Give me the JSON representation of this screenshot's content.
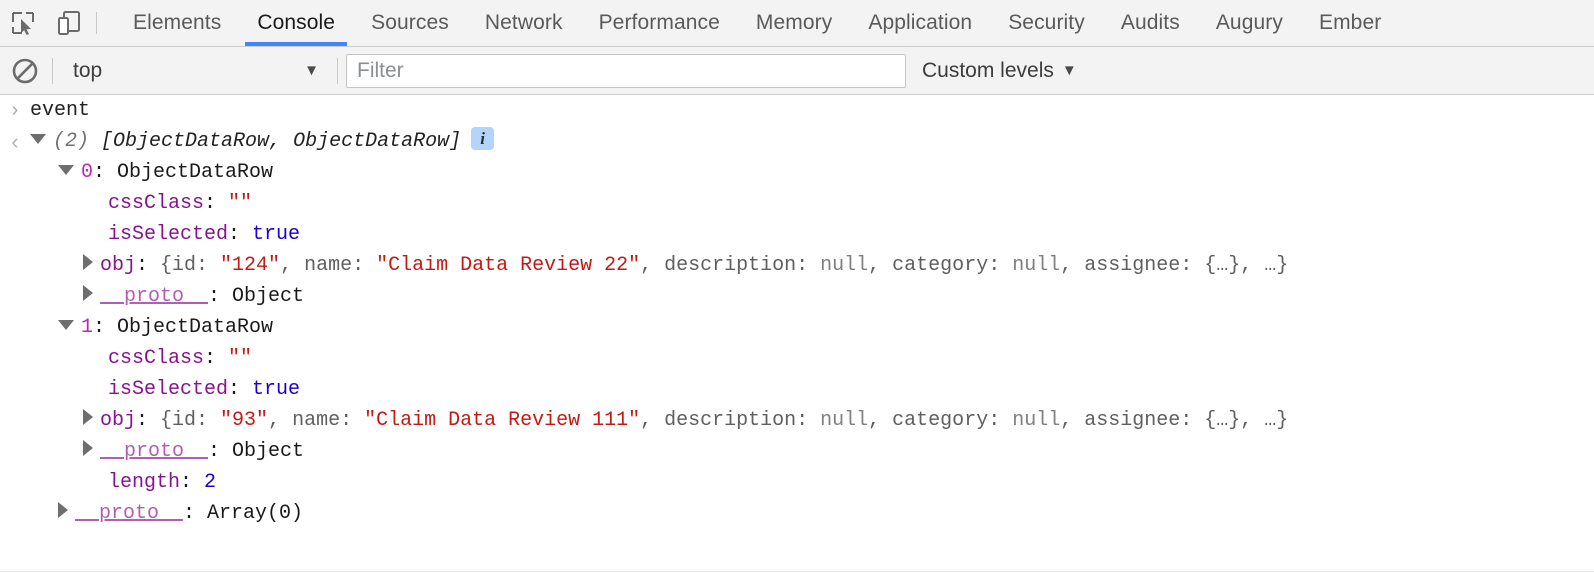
{
  "theme": {
    "accent": "#4285f4",
    "toolbar_bg": "#f3f3f3",
    "border": "#cdcdcd",
    "string_color": "#c41a16",
    "number_color": "#1c00cf",
    "property_color": "#881391",
    "index_color": "#c125b8",
    "proto_color": "#b15fb3",
    "null_color": "#808080",
    "info_badge_bg": "#b3d4fd"
  },
  "toolbar": {
    "inspect_icon": "inspect-element-icon",
    "device_icon": "device-toolbar-icon",
    "tabs": [
      {
        "label": "Elements",
        "active": false
      },
      {
        "label": "Console",
        "active": true
      },
      {
        "label": "Sources",
        "active": false
      },
      {
        "label": "Network",
        "active": false
      },
      {
        "label": "Performance",
        "active": false
      },
      {
        "label": "Memory",
        "active": false
      },
      {
        "label": "Application",
        "active": false
      },
      {
        "label": "Security",
        "active": false
      },
      {
        "label": "Audits",
        "active": false
      },
      {
        "label": "Augury",
        "active": false
      },
      {
        "label": "Ember",
        "active": false
      }
    ]
  },
  "filterbar": {
    "clear_icon": "clear-console-icon",
    "context": "top",
    "context_caret": "▼",
    "filter_value": "",
    "filter_placeholder": "Filter",
    "levels_label": "Custom levels",
    "levels_caret": "▼"
  },
  "console": {
    "prompt_glyph": "›",
    "result_glyph": "‹",
    "input_text": "event",
    "info_badge": "i",
    "summary": {
      "count": "(2)",
      "body": "[ObjectDataRow, ObjectDataRow]"
    },
    "lines": [
      {
        "id": "row0-header",
        "indent": 1,
        "tri": "open",
        "key": "0",
        "key_kind": "index",
        "sep": ": ",
        "value": "ObjectDataRow",
        "value_kind": "plain"
      },
      {
        "id": "row0-cssClass",
        "indent": 2,
        "tri": "none",
        "key": "cssClass",
        "key_kind": "name",
        "sep": ": ",
        "value": "\"\"",
        "value_kind": "string"
      },
      {
        "id": "row0-isSelected",
        "indent": 2,
        "tri": "none",
        "key": "isSelected",
        "key_kind": "name",
        "sep": ": ",
        "value": "true",
        "value_kind": "bool"
      },
      {
        "id": "row0-obj",
        "indent": 2,
        "tri": "closed",
        "key": "obj",
        "key_kind": "name",
        "sep": ": ",
        "value_kind": "object-preview",
        "preview": [
          {
            "t": "{id: ",
            "c": "dim"
          },
          {
            "t": "\"124\"",
            "c": "string"
          },
          {
            "t": ", name: ",
            "c": "dim"
          },
          {
            "t": "\"Claim Data Review 22\"",
            "c": "string"
          },
          {
            "t": ", description: ",
            "c": "dim"
          },
          {
            "t": "null",
            "c": "null"
          },
          {
            "t": ", category: ",
            "c": "dim"
          },
          {
            "t": "null",
            "c": "null"
          },
          {
            "t": ", assignee: ",
            "c": "dim"
          },
          {
            "t": "{…}, …}",
            "c": "dim"
          }
        ]
      },
      {
        "id": "row0-proto",
        "indent": 2,
        "tri": "closed",
        "key": "__proto__",
        "key_kind": "proto",
        "sep": ": ",
        "value": "Object",
        "value_kind": "plain"
      },
      {
        "id": "row1-header",
        "indent": 1,
        "tri": "open",
        "key": "1",
        "key_kind": "index",
        "sep": ": ",
        "value": "ObjectDataRow",
        "value_kind": "plain"
      },
      {
        "id": "row1-cssClass",
        "indent": 2,
        "tri": "none",
        "key": "cssClass",
        "key_kind": "name",
        "sep": ": ",
        "value": "\"\"",
        "value_kind": "string"
      },
      {
        "id": "row1-isSelected",
        "indent": 2,
        "tri": "none",
        "key": "isSelected",
        "key_kind": "name",
        "sep": ": ",
        "value": "true",
        "value_kind": "bool"
      },
      {
        "id": "row1-obj",
        "indent": 2,
        "tri": "closed",
        "key": "obj",
        "key_kind": "name",
        "sep": ": ",
        "value_kind": "object-preview",
        "preview": [
          {
            "t": "{id: ",
            "c": "dim"
          },
          {
            "t": "\"93\"",
            "c": "string"
          },
          {
            "t": ", name: ",
            "c": "dim"
          },
          {
            "t": "\"Claim Data Review 111\"",
            "c": "string"
          },
          {
            "t": ", description: ",
            "c": "dim"
          },
          {
            "t": "null",
            "c": "null"
          },
          {
            "t": ", category: ",
            "c": "dim"
          },
          {
            "t": "null",
            "c": "null"
          },
          {
            "t": ", assignee: ",
            "c": "dim"
          },
          {
            "t": "{…}, …}",
            "c": "dim"
          }
        ]
      },
      {
        "id": "row1-proto",
        "indent": 2,
        "tri": "closed",
        "key": "__proto__",
        "key_kind": "proto",
        "sep": ": ",
        "value": "Object",
        "value_kind": "plain"
      },
      {
        "id": "array-length",
        "indent": 2,
        "tri": "none",
        "key": "length",
        "key_kind": "name",
        "sep": ": ",
        "value": "2",
        "value_kind": "number"
      },
      {
        "id": "array-proto",
        "indent": 1,
        "tri": "closed",
        "key": "__proto__",
        "key_kind": "proto",
        "sep": ": ",
        "value": "Array(0)",
        "value_kind": "plain"
      }
    ]
  }
}
